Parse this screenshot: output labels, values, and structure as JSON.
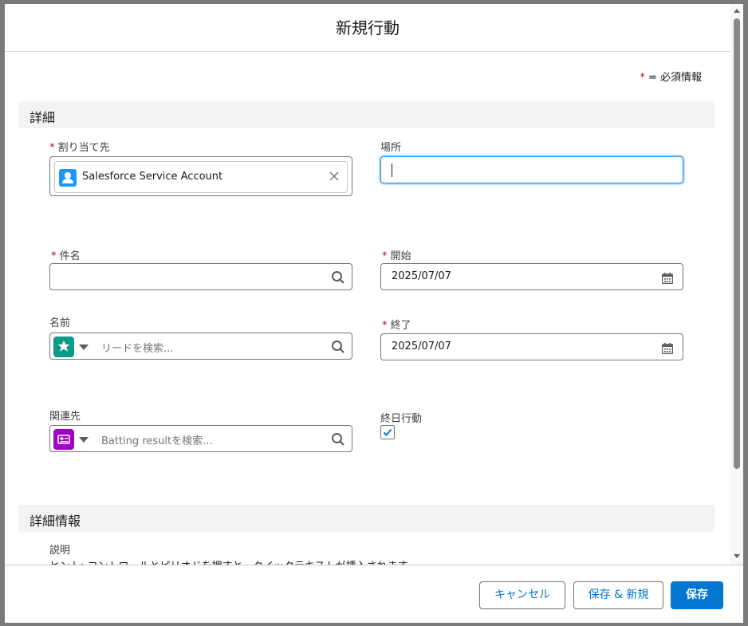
{
  "modal": {
    "title": "新規行動",
    "required_note": "= 必須情報",
    "required_mark": "*"
  },
  "sections": {
    "details": "詳細",
    "details_info": "詳細情報"
  },
  "fields": {
    "assigned_to": {
      "label": "割り当て先",
      "value": "Salesforce Service Account"
    },
    "location": {
      "label": "場所",
      "value": ""
    },
    "subject": {
      "label": "件名",
      "value": ""
    },
    "start": {
      "label": "開始",
      "value": "2025/07/07"
    },
    "name": {
      "label": "名前",
      "placeholder": "リードを検索..."
    },
    "end": {
      "label": "終了",
      "value": "2025/07/07"
    },
    "related_to": {
      "label": "関連先",
      "placeholder": "Batting resultを検索..."
    },
    "all_day": {
      "label": "終日行動",
      "checked": true
    },
    "description": {
      "label": "説明",
      "hint": "ヒント: コントロールとピリオドを押すと、クイックテキストが挿入されます。"
    }
  },
  "footer": {
    "cancel_label": "キャンセル",
    "save_new_label": "保存 & 新規",
    "save_label": "保存"
  },
  "icons": {
    "assigned_user": "user-icon",
    "lead": "lead-icon",
    "related": "custom-object-icon",
    "search": "search-icon",
    "calendar": "calendar-icon",
    "clear": "close-icon"
  },
  "colors": {
    "brand": "#0176d3",
    "required": "#ba0517",
    "lead_icon": "#0b9b8a",
    "related_icon": "#a100c9",
    "user_icon": "#1b96ff"
  }
}
